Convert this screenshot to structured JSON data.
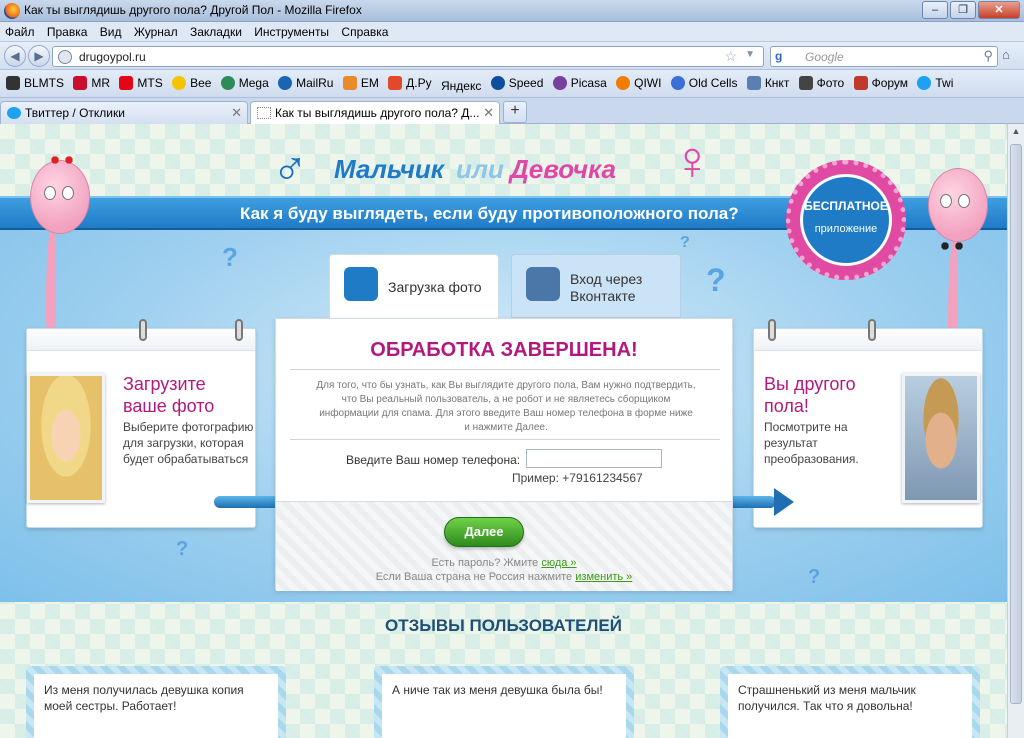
{
  "window": {
    "title": "Как ты выглядишь другого пола? Другой Пол - Mozilla Firefox"
  },
  "menu": [
    "Файл",
    "Правка",
    "Вид",
    "Журнал",
    "Закладки",
    "Инструменты",
    "Справка"
  ],
  "nav": {
    "url": "drugoypol.ru",
    "search_placeholder": "Google",
    "search_engine": "g"
  },
  "bookmarks": [
    {
      "label": "BLMTS",
      "color": "#333333"
    },
    {
      "label": "MR",
      "color": "#c8102e"
    },
    {
      "label": "MTS",
      "color": "#e30613"
    },
    {
      "label": "Bee",
      "color": "#f5c400"
    },
    {
      "label": "Mega",
      "color": "#2e8b57"
    },
    {
      "label": "MailRu",
      "color": "#1a64b4"
    },
    {
      "label": "EM",
      "color": "#e98a2b"
    },
    {
      "label": "Д.Ру",
      "color": "#e04a2b"
    },
    {
      "label": "Яндекс",
      "color": "#cc0000"
    },
    {
      "label": "Speed",
      "color": "#0d4f9e"
    },
    {
      "label": "Picasa",
      "color": "#7a3ea0"
    },
    {
      "label": "QIWI",
      "color": "#f07d00"
    },
    {
      "label": "Old Cells",
      "color": "#3b6fd6"
    },
    {
      "label": "Кнкт",
      "color": "#5b7fb3"
    },
    {
      "label": "Фото",
      "color": "#444444"
    },
    {
      "label": "Форум",
      "color": "#c0392b"
    },
    {
      "label": "Twi",
      "color": "#1da1f2"
    }
  ],
  "tabs": [
    {
      "label": "Твиттер / Отклики"
    },
    {
      "label": "Как ты выглядишь другого пола? Д..."
    }
  ],
  "page": {
    "logo": {
      "part1": "Мальчик",
      "part2": "или",
      "part3": "Девочка"
    },
    "tagline": "Как я буду выглядеть, если буду противоположного пола?",
    "badge": {
      "line1": "БЕСПЛАТНОЕ",
      "line2": "приложение"
    },
    "form_tabs": {
      "upload": "Загрузка фото",
      "vk": "Вход через Вконтакте"
    },
    "left_card": {
      "title": "Загрузите ваше фото",
      "text": "Выберите фотографию для загрузки, которая будет обрабатываться"
    },
    "right_card": {
      "title": "Вы другого пола!",
      "text": "Посмотрите на результат преобразования."
    },
    "main": {
      "heading": "ОБРАБОТКА ЗАВЕРШЕНА!",
      "description": "Для того, что бы узнать, как Вы выглядите другого пола, Вам нужно подтвердить, что Вы реальный пользователь, а не робот и не являетесь сборщиком информации для спама. Для этого введите Ваш номер телефона в форме ниже и нажмите Далее.",
      "phone_label": "Введите Ваш номер телефона:",
      "phone_value": "",
      "example": "Пример: +79161234567",
      "next_button": "Далее",
      "password_text": "Есть пароль? Жмите",
      "password_link": "сюда »",
      "country_text": "Если Ваша страна не Россия нажмите",
      "country_link": "изменить »"
    },
    "reviews_title": "ОТЗЫВЫ ПОЛЬЗОВАТЕЛЕЙ",
    "reviews": [
      "Из меня получилась девушка копия моей сестры. Работает!",
      "А ниче так из меня девушка была бы!",
      "Страшненький из меня мальчик получился. Так что я довольна!"
    ]
  },
  "colors": {
    "brand_blue": "#1f7bc6",
    "brand_pink": "#b2197e",
    "button_green": "#3c9b18"
  }
}
